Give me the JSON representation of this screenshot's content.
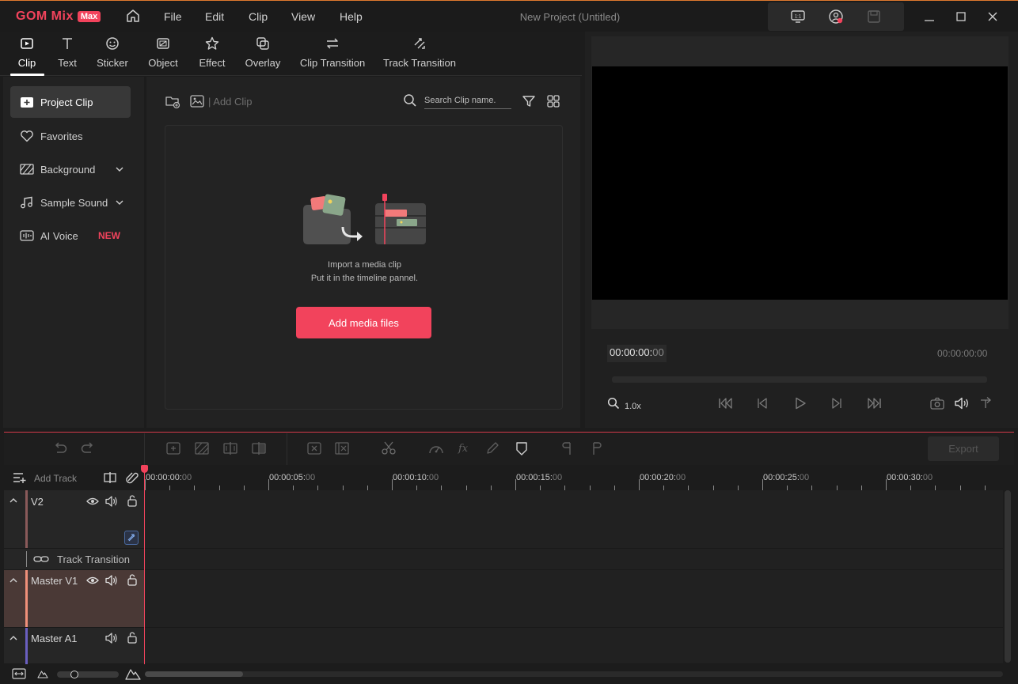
{
  "app": {
    "logo_text": "GOM Mix",
    "logo_badge": "Max",
    "project_title": "New Project (Untitled)"
  },
  "menu": {
    "file": "File",
    "edit": "Edit",
    "clip": "Clip",
    "view": "View",
    "help": "Help"
  },
  "tabs": {
    "clip": "Clip",
    "text": "Text",
    "sticker": "Sticker",
    "object": "Object",
    "effect": "Effect",
    "overlay": "Overlay",
    "clip_transition": "Clip Transition",
    "track_transition": "Track Transition"
  },
  "sidebar": {
    "project_clip": "Project Clip",
    "favorites": "Favorites",
    "background": "Background",
    "sample_sound": "Sample Sound",
    "ai_voice": "AI Voice",
    "new_badge": "NEW"
  },
  "media": {
    "add_clip": "Add Clip",
    "search_placeholder": "Search Clip name.",
    "import_line1": "Import a media clip",
    "import_line2": "Put it in the timeline pannel.",
    "add_media_button": "Add media files"
  },
  "preview": {
    "current_time_main": "00:00:00:",
    "current_time_frames": "00",
    "total_time": "00:00:00:00",
    "zoom": "1.0x"
  },
  "toolbar": {
    "export": "Export"
  },
  "timeline": {
    "add_track": "Add Track",
    "ticks": [
      {
        "main": "00:00:00:",
        "frames": "00"
      },
      {
        "main": "00:00:05:",
        "frames": "00"
      },
      {
        "main": "00:00:10:",
        "frames": "00"
      },
      {
        "main": "00:00:15:",
        "frames": "00"
      },
      {
        "main": "00:00:20:",
        "frames": "00"
      },
      {
        "main": "00:00:25:",
        "frames": "00"
      },
      {
        "main": "00:00:30:",
        "frames": "00"
      }
    ],
    "tracks": {
      "v2": "V2",
      "track_transition": "Track Transition",
      "master_v1": "Master V1",
      "master_a1": "Master A1"
    }
  },
  "colors": {
    "accent": "#f2435c",
    "v2_stripe": "#8a5a5a",
    "master_v1_stripe": "#f0907a",
    "master_a1_stripe": "#6a5fc0"
  }
}
